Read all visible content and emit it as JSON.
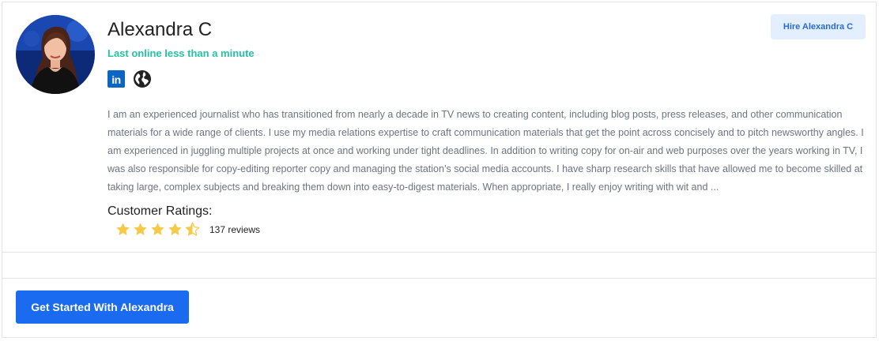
{
  "profile": {
    "name": "Alexandra C",
    "status": "Last online less than a minute",
    "status_color": "#22c3a2",
    "linkedin_icon_text": "in",
    "bio": "I am an experienced journalist who has transitioned from nearly a decade in TV news to creating content, including blog posts, press releases, and other communication materials for a wide range of clients. I use my media relations expertise to craft communication materials that get the point across concisely and to pitch newsworthy angles. I am experienced in juggling multiple projects at once and working under tight deadlines. In addition to writing copy for on-air and web purposes over the years working in TV, I was also responsible for copy-editing reporter copy and managing the station’s social media accounts. I have sharp research skills that have allowed me to become skilled at taking large, complex subjects and breaking them down into easy-to-digest materials. When appropriate, I really enjoy writing with wit and ..."
  },
  "actions": {
    "hire_label": "Hire Alexandra C",
    "get_started_label": "Get Started With Alexandra"
  },
  "ratings": {
    "label": "Customer Ratings:",
    "stars": 4.5,
    "max_stars": 5,
    "reviews_text": "137 reviews",
    "star_color": "#f7c948"
  },
  "icons": [
    "linkedin-icon",
    "globe-icon",
    "star-icon"
  ],
  "colors": {
    "accent": "#1a6bf0",
    "hire_bg": "#e3efff",
    "hire_text": "#2a6ad6"
  }
}
